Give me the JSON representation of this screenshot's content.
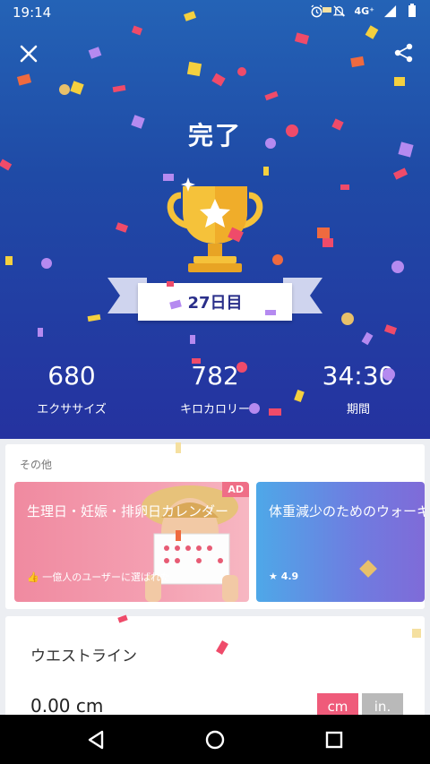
{
  "status_bar": {
    "time": "19:14",
    "network": "4G⁺",
    "icons": [
      "alarm-icon",
      "mute-icon",
      "signal-icon",
      "battery-icon"
    ]
  },
  "header": {
    "close_icon": "close-icon",
    "share_icon": "share-icon",
    "title": "完了"
  },
  "trophy": {
    "day_label": "27日目"
  },
  "stats": [
    {
      "value": "680",
      "label": "エクササイズ"
    },
    {
      "value": "782",
      "label": "キロカロリー"
    },
    {
      "value": "34:30",
      "label": "期間"
    }
  ],
  "more_section": {
    "heading": "その他",
    "promos": [
      {
        "title": "生理日・妊娠・排卵日カレンダー",
        "subtitle": "一億人のユーザーに選ばれた",
        "badge": "AD"
      },
      {
        "title": "体重減少のためのウォーキング",
        "rating": "4.9"
      }
    ]
  },
  "waist": {
    "title": "ウエストライン",
    "value": "0.00 cm",
    "unit_cm": "cm",
    "unit_in": "in."
  },
  "colors": {
    "accent": "#ef5b7a",
    "hero_top": "#2463b6",
    "hero_bottom": "#2532a0",
    "trophy_gold": "#f5c23a"
  }
}
